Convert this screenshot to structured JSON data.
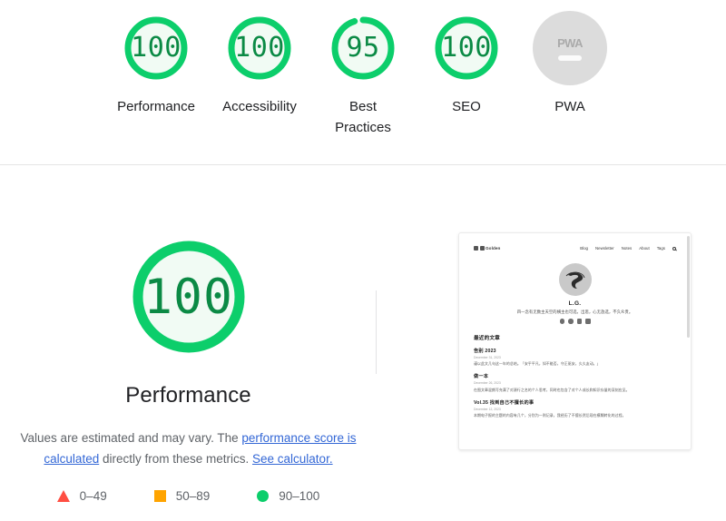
{
  "report": {
    "category_scores": [
      {
        "id": "performance",
        "value": "100",
        "label": "Performance",
        "percent": 100,
        "rating": "pass"
      },
      {
        "id": "accessibility",
        "value": "100",
        "label": "Accessibility",
        "percent": 100,
        "rating": "pass"
      },
      {
        "id": "best-practices",
        "value": "95",
        "label": "Best\nPractices",
        "percent": 95,
        "rating": "pass"
      },
      {
        "id": "seo",
        "value": "100",
        "label": "SEO",
        "percent": 100,
        "rating": "pass"
      },
      {
        "id": "pwa",
        "value": "PWA",
        "label": "PWA",
        "percent": 0,
        "rating": "null"
      }
    ],
    "pwa_badge_text": "PWA"
  },
  "performance_section": {
    "score": "100",
    "percent": 100,
    "title": "Performance",
    "note_prefix": "Values are estimated and may vary. The ",
    "note_link1": "performance score is calculated",
    "note_middle": " directly from these metrics. ",
    "note_link2": "See calculator.",
    "legend": [
      {
        "marker": "triangle-marker",
        "range": "0–49",
        "color": "#ff4e42"
      },
      {
        "marker": "square-marker",
        "range": "50–89",
        "color": "#ffa400"
      },
      {
        "marker": "circle-marker",
        "range": "90–100",
        "color": "#0cce6b"
      }
    ]
  },
  "thumbnail": {
    "site_brand": "Golden",
    "nav": [
      "Blog",
      "Newsletter",
      "Notes",
      "About",
      "Tags"
    ],
    "search_icon": "search-icon",
    "author_name": "L.G.",
    "tagline": "四一念有无数主天空的横主也可选，出思，心无放选，不久众贵。",
    "section_title": "最近的文章",
    "posts": [
      {
        "title": "告别 2023",
        "date": "December 31, 2023",
        "excerpt": "谨以此文几句这一年的总结。「安乎平凡，如不能否，守正驱安，久久友动。」"
      },
      {
        "title": "做一本",
        "date": "December 26, 2023",
        "excerpt": "在图文章混朗写充满了对源行之名的个人思考，同时也包含了对个人成长和知识存量的深刻应见。"
      },
      {
        "title": "Vol.35 找到自己不擅长的事",
        "date": "December 12, 2023",
        "excerpt": "本期电子报的主题的内容有几个，分别为一则记录，我经历了不擅长然后现在模糊转化的过程。"
      }
    ]
  }
}
